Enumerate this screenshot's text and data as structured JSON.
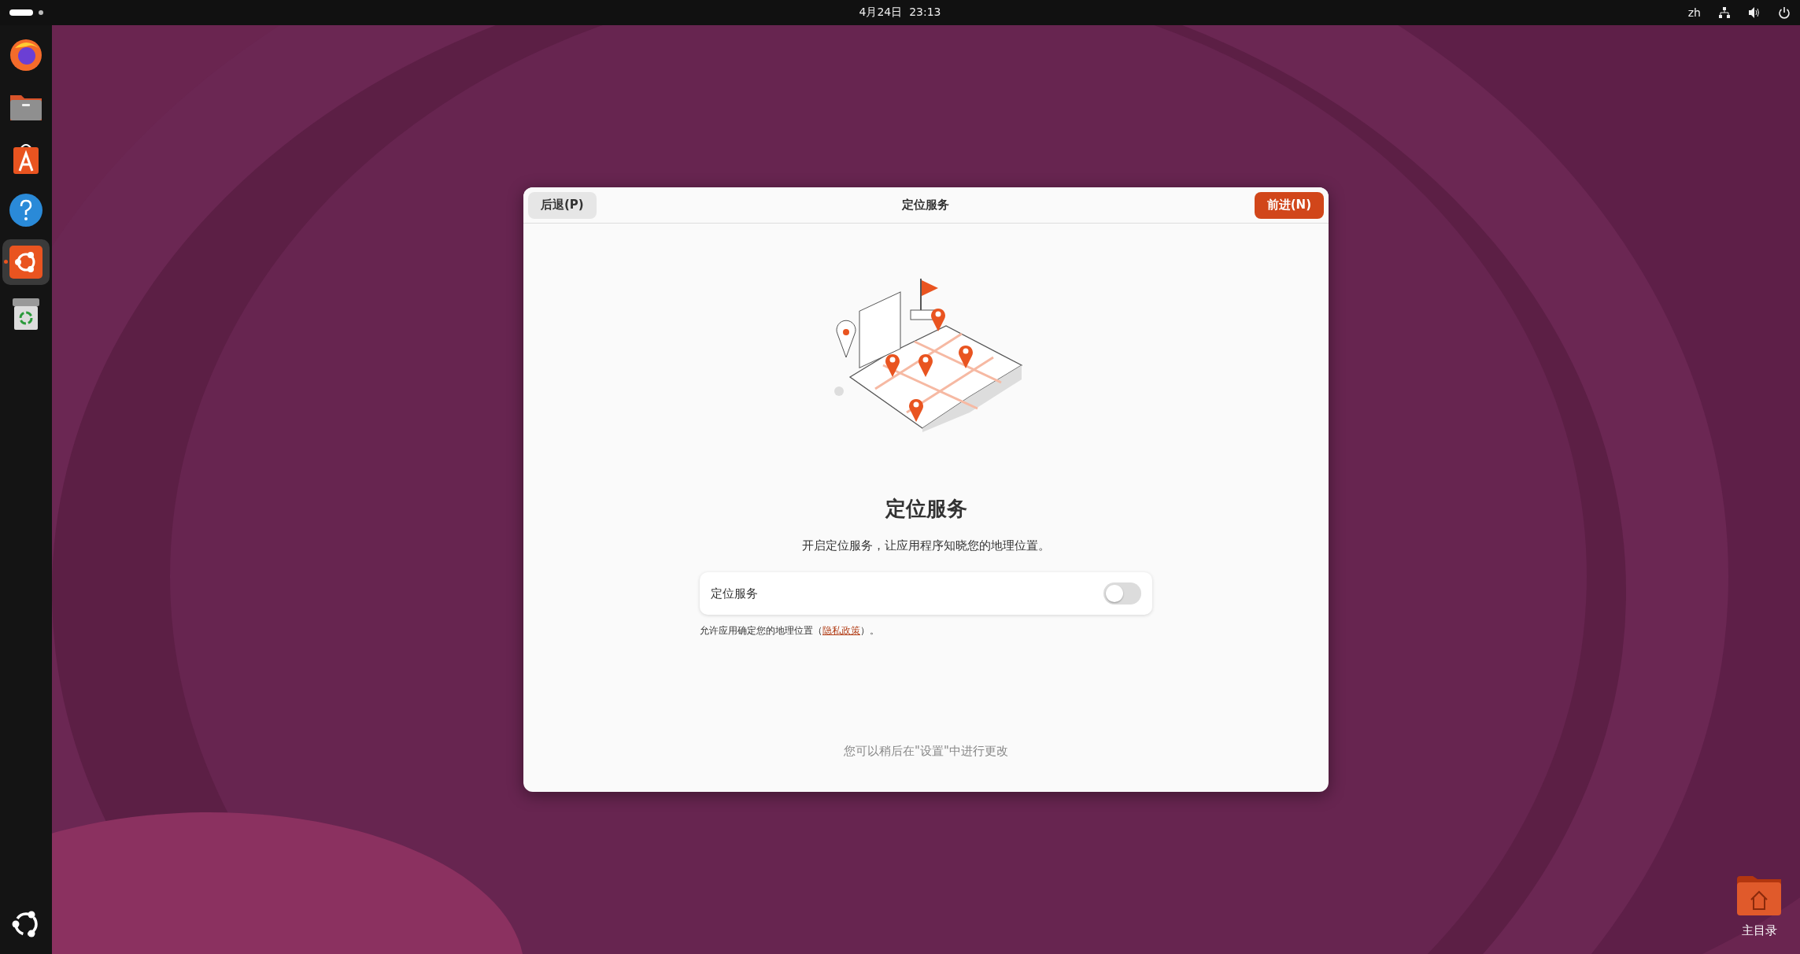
{
  "top_bar": {
    "clock": "4月24日  23:13",
    "language": "zh"
  },
  "dock": {
    "items": [
      {
        "kind": "browser",
        "selected": false
      },
      {
        "kind": "files",
        "selected": false
      },
      {
        "kind": "store",
        "selected": false
      },
      {
        "kind": "help",
        "selected": false
      },
      {
        "kind": "installer",
        "selected": true
      },
      {
        "kind": "trash",
        "selected": false
      }
    ]
  },
  "dialog": {
    "back_button": "后退(P)",
    "title": "定位服务",
    "next_button": "前进(N)",
    "heading": "定位服务",
    "description": "开启定位服务，让应用程序知晓您的地理位置。",
    "setting": {
      "label": "定位服务",
      "on": false
    },
    "note": {
      "before": "允许应用确定您的地理位置（",
      "link": "隐私政策",
      "after": "）。"
    },
    "footer": "您可以稍后在\"设置\"中进行更改"
  },
  "desktop_icons": [
    {
      "label": "主目录"
    }
  ]
}
